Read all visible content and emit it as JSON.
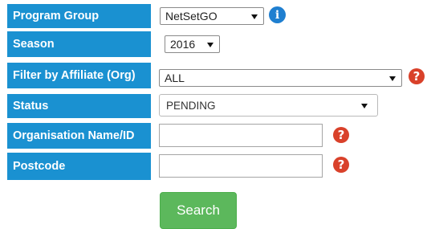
{
  "form": {
    "program_group": {
      "label": "Program Group",
      "value": "NetSetGO"
    },
    "season": {
      "label": "Season",
      "value": "2016"
    },
    "affiliate": {
      "label": "Filter by Affiliate (Org)",
      "value": "ALL"
    },
    "status": {
      "label": "Status",
      "value": "PENDING"
    },
    "org_name": {
      "label": "Organisation Name/ID",
      "value": "",
      "placeholder": ""
    },
    "postcode": {
      "label": "Postcode",
      "value": "",
      "placeholder": ""
    }
  },
  "icons": {
    "info": "info-icon",
    "help": "question-mark-icon",
    "info_glyph": "i",
    "help_glyph": "?"
  },
  "colors": {
    "label_bg": "#1a91d1",
    "search_button": "#5cb85c",
    "help_icon": "#d9412a",
    "info_icon": "#1f7fd0"
  },
  "actions": {
    "search_label": "Search"
  }
}
